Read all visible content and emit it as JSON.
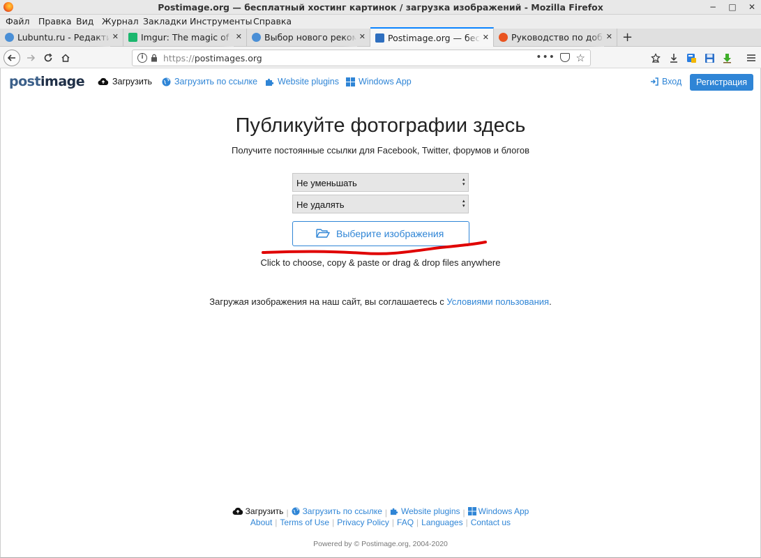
{
  "window": {
    "title": "Postimage.org — бесплатный хостинг картинок / загрузка изображений - Mozilla Firefox",
    "controls": [
      "−",
      "□",
      "✕"
    ]
  },
  "menu": [
    "Файл",
    "Правка",
    "Вид",
    "Журнал",
    "Закладки",
    "Инструменты",
    "Справка"
  ],
  "tabs": [
    {
      "label": "Lubuntu.ru - Редактирование",
      "favicon_color": "#4a8fd6",
      "active": false
    },
    {
      "label": "Imgur: The magic of the Internet",
      "favicon_color": "#1bb76e",
      "active": false
    },
    {
      "label": "Выбор нового рекомендованного",
      "favicon_color": "#4a8fd6",
      "active": false
    },
    {
      "label": "Postimage.org — бесплатный",
      "favicon_color": "#2f6fbf",
      "active": true
    },
    {
      "label": "Руководство по добавлению",
      "favicon_color": "#e95420",
      "active": false
    }
  ],
  "newtab_label": "+",
  "tab_close": "✕",
  "address": {
    "scheme": "https://",
    "host": "postimages.org",
    "dots": "•••"
  },
  "site": {
    "logo_a": "post",
    "logo_b": "image",
    "nav": {
      "upload": "Загрузить",
      "upload_url": "Загрузить по ссылке",
      "plugins": "Website plugins",
      "windows_app": "Windows App",
      "login": "Вход",
      "register": "Регистрация"
    },
    "hero_title": "Публикуйте фотографии здесь",
    "hero_sub": "Получите постоянные ссылки для Facebook, Twitter, форумов и блогов",
    "resize_select": "Не уменьшать",
    "expire_select": "Не удалять",
    "choose_button": "Выберите изображения",
    "hint": "Click to choose, copy & paste or drag & drop files anywhere",
    "terms_prefix": "Загружая изображения на наш сайт, вы соглашаетесь с ",
    "terms_link": "Условиями пользования",
    "terms_suffix": "."
  },
  "footer": {
    "upload": "Загрузить",
    "upload_url": "Загрузить по ссылке",
    "plugins": "Website plugins",
    "windows_app": "Windows App",
    "links": [
      "About",
      "Terms of Use",
      "Privacy Policy",
      "FAQ",
      "Languages",
      "Contact us"
    ],
    "powered": "Powered by © Postimage.org, 2004-2020"
  },
  "colors": {
    "accent": "#2f85d6",
    "annotation": "#e00000"
  }
}
